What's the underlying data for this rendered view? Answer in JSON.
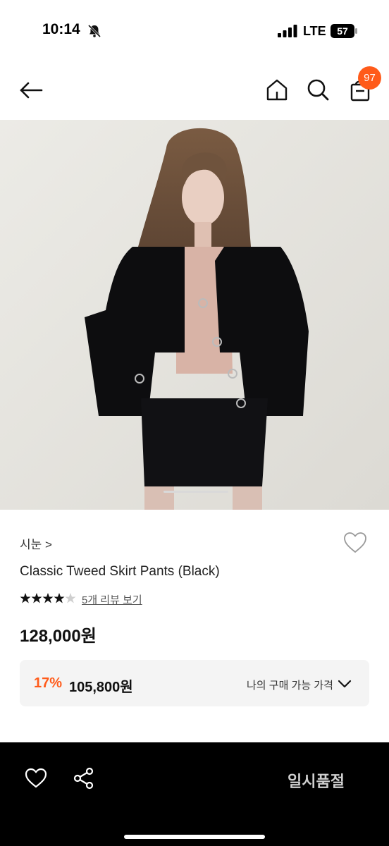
{
  "status_bar": {
    "time": "10:14",
    "network": "LTE",
    "battery": "57"
  },
  "nav": {
    "cart_count": "97"
  },
  "product": {
    "brand": "시눈 >",
    "name": "Classic Tweed Skirt Pants (Black)",
    "rating_stars": 4.5,
    "review_link": "5개 리뷰 보기",
    "original_price": "128,000원",
    "discount_rate": "17%",
    "sale_price": "105,800원",
    "purchase_label": "나의 구매 가능 가격"
  },
  "bottom_bar": {
    "sold_out_label": "일시품절"
  },
  "colors": {
    "accent": "#ff5b1a",
    "bottom_bar": "#000000",
    "price_box": "#f4f4f4"
  }
}
